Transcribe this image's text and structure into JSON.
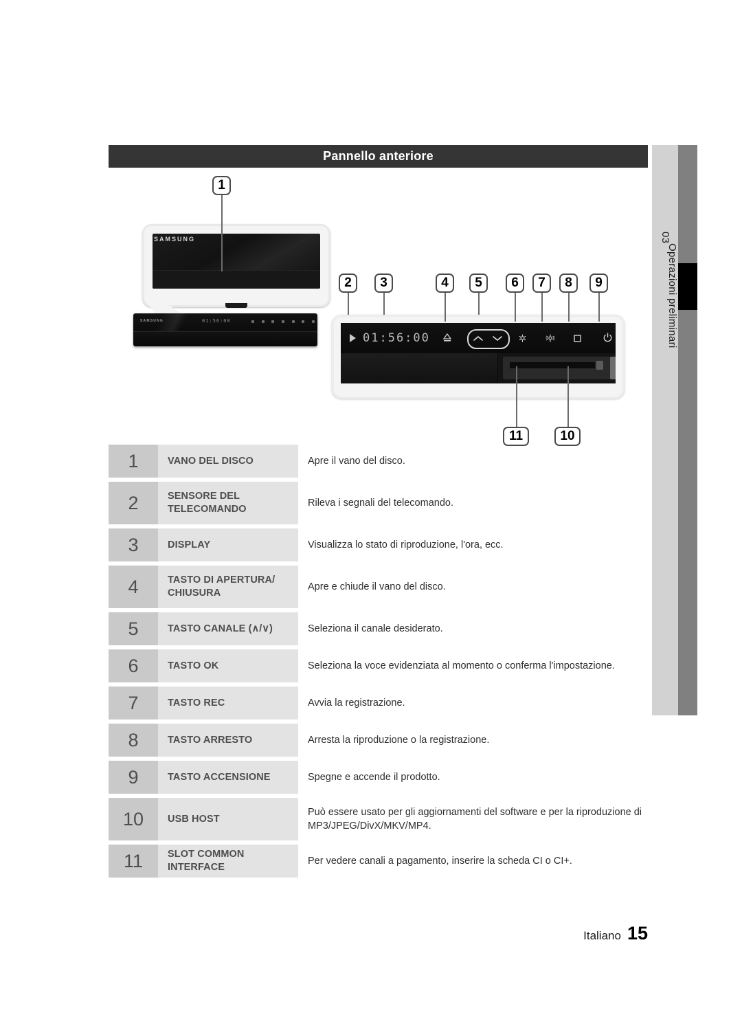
{
  "header": {
    "title": "Pannello anteriore"
  },
  "side_tab": {
    "chapter": "03",
    "label": "Operazioni preliminari"
  },
  "illustration": {
    "brand": "SAMSUNG",
    "display_value": "01:56:00",
    "front_panel_icons": [
      "play-icon",
      "eject-icon",
      "channel-up-icon",
      "channel-down-icon",
      "rec-icon",
      "rec-alt-icon",
      "stop-icon",
      "power-icon"
    ],
    "ports": [
      "ci-card-slot",
      "usb-port"
    ],
    "callouts": [
      {
        "number": "1"
      },
      {
        "number": "2"
      },
      {
        "number": "3"
      },
      {
        "number": "4"
      },
      {
        "number": "5"
      },
      {
        "number": "6"
      },
      {
        "number": "7"
      },
      {
        "number": "8"
      },
      {
        "number": "9"
      },
      {
        "number": "10"
      },
      {
        "number": "11"
      }
    ]
  },
  "table": {
    "rows": [
      {
        "number": "1",
        "name": "VANO DEL DISCO",
        "description": "Apre il vano del disco."
      },
      {
        "number": "2",
        "name": "SENSORE DEL TELECOMANDO",
        "description": "Rileva i segnali del telecomando."
      },
      {
        "number": "3",
        "name": "DISPLAY",
        "description": "Visualizza lo stato di riproduzione, l'ora, ecc."
      },
      {
        "number": "4",
        "name": "TASTO DI APERTURA/ CHIUSURA",
        "description": "Apre e chiude il vano del disco."
      },
      {
        "number": "5",
        "name": "TASTO CANALE (∧/∨)",
        "description": "Seleziona il canale desiderato."
      },
      {
        "number": "6",
        "name": "TASTO OK",
        "description": "Seleziona la voce evidenziata al momento o conferma l'impostazione."
      },
      {
        "number": "7",
        "name": "TASTO REC",
        "description": "Avvia la registrazione."
      },
      {
        "number": "8",
        "name": "TASTO ARRESTO",
        "description": "Arresta la riproduzione o la registrazione."
      },
      {
        "number": "9",
        "name": "TASTO ACCENSIONE",
        "description": "Spegne e accende il prodotto."
      },
      {
        "number": "10",
        "name": "USB HOST",
        "description": "Può essere usato per gli aggiornamenti del software e per la riproduzione di MP3/JPEG/DivX/MKV/MP4."
      },
      {
        "number": "11",
        "name": "SLOT COMMON INTERFACE",
        "description": "Per vedere canali a pagamento, inserire la scheda CI o CI+."
      }
    ]
  },
  "footer": {
    "language": "Italiano",
    "page_number": "15"
  }
}
